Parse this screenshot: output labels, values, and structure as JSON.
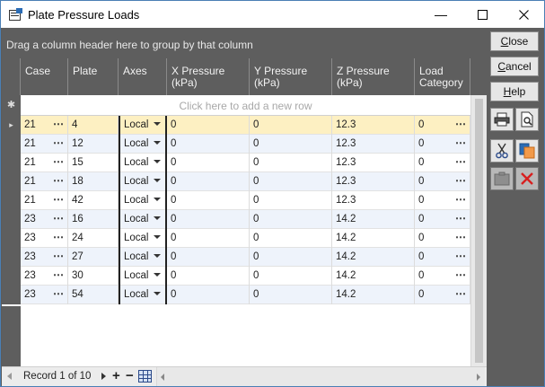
{
  "window": {
    "title": "Plate Pressure Loads"
  },
  "group_bar": {
    "text": "Drag a column header here to group by that column"
  },
  "columns": [
    "Case",
    "Plate",
    "Axes",
    "X Pressure\n(kPa)",
    "Y Pressure\n(kPa)",
    "Z Pressure\n(kPa)",
    "Load\nCategory"
  ],
  "column_lines": [
    [
      "Case"
    ],
    [
      "Plate"
    ],
    [
      "Axes"
    ],
    [
      "X Pressure",
      "(kPa)"
    ],
    [
      "Y Pressure",
      "(kPa)"
    ],
    [
      "Z Pressure",
      "(kPa)"
    ],
    [
      "Load",
      "Category"
    ]
  ],
  "new_row": {
    "text": "Click here to add a new row",
    "indicator": "✱"
  },
  "rows": [
    {
      "case": "21",
      "plate": "4",
      "axes": "Local",
      "x": "0",
      "y": "0",
      "z": "12.3",
      "cat": "0",
      "selected": true
    },
    {
      "case": "21",
      "plate": "12",
      "axes": "Local",
      "x": "0",
      "y": "0",
      "z": "12.3",
      "cat": "0"
    },
    {
      "case": "21",
      "plate": "15",
      "axes": "Local",
      "x": "0",
      "y": "0",
      "z": "12.3",
      "cat": "0"
    },
    {
      "case": "21",
      "plate": "18",
      "axes": "Local",
      "x": "0",
      "y": "0",
      "z": "12.3",
      "cat": "0"
    },
    {
      "case": "21",
      "plate": "42",
      "axes": "Local",
      "x": "0",
      "y": "0",
      "z": "12.3",
      "cat": "0"
    },
    {
      "case": "23",
      "plate": "16",
      "axes": "Local",
      "x": "0",
      "y": "0",
      "z": "14.2",
      "cat": "0"
    },
    {
      "case": "23",
      "plate": "24",
      "axes": "Local",
      "x": "0",
      "y": "0",
      "z": "14.2",
      "cat": "0"
    },
    {
      "case": "23",
      "plate": "27",
      "axes": "Local",
      "x": "0",
      "y": "0",
      "z": "14.2",
      "cat": "0"
    },
    {
      "case": "23",
      "plate": "30",
      "axes": "Local",
      "x": "0",
      "y": "0",
      "z": "14.2",
      "cat": "0"
    },
    {
      "case": "23",
      "plate": "54",
      "axes": "Local",
      "x": "0",
      "y": "0",
      "z": "14.2",
      "cat": "0"
    }
  ],
  "footer": {
    "record_text": "Record 1 of 10"
  },
  "side_buttons": {
    "close": {
      "u": "C",
      "rest": "lose"
    },
    "cancel": {
      "u": "C",
      "rest": "ancel"
    },
    "help": {
      "u": "H",
      "rest": "elp"
    }
  },
  "icons": [
    "app-window-icon",
    "print-icon",
    "print-preview-icon",
    "cut-icon",
    "copy-icon",
    "paste-icon",
    "delete-icon",
    "grid-icon"
  ],
  "colors": {
    "selected_row": "#fdf0c2",
    "alt_row": "#eef3fb",
    "header_bg": "#5e5e5e"
  }
}
